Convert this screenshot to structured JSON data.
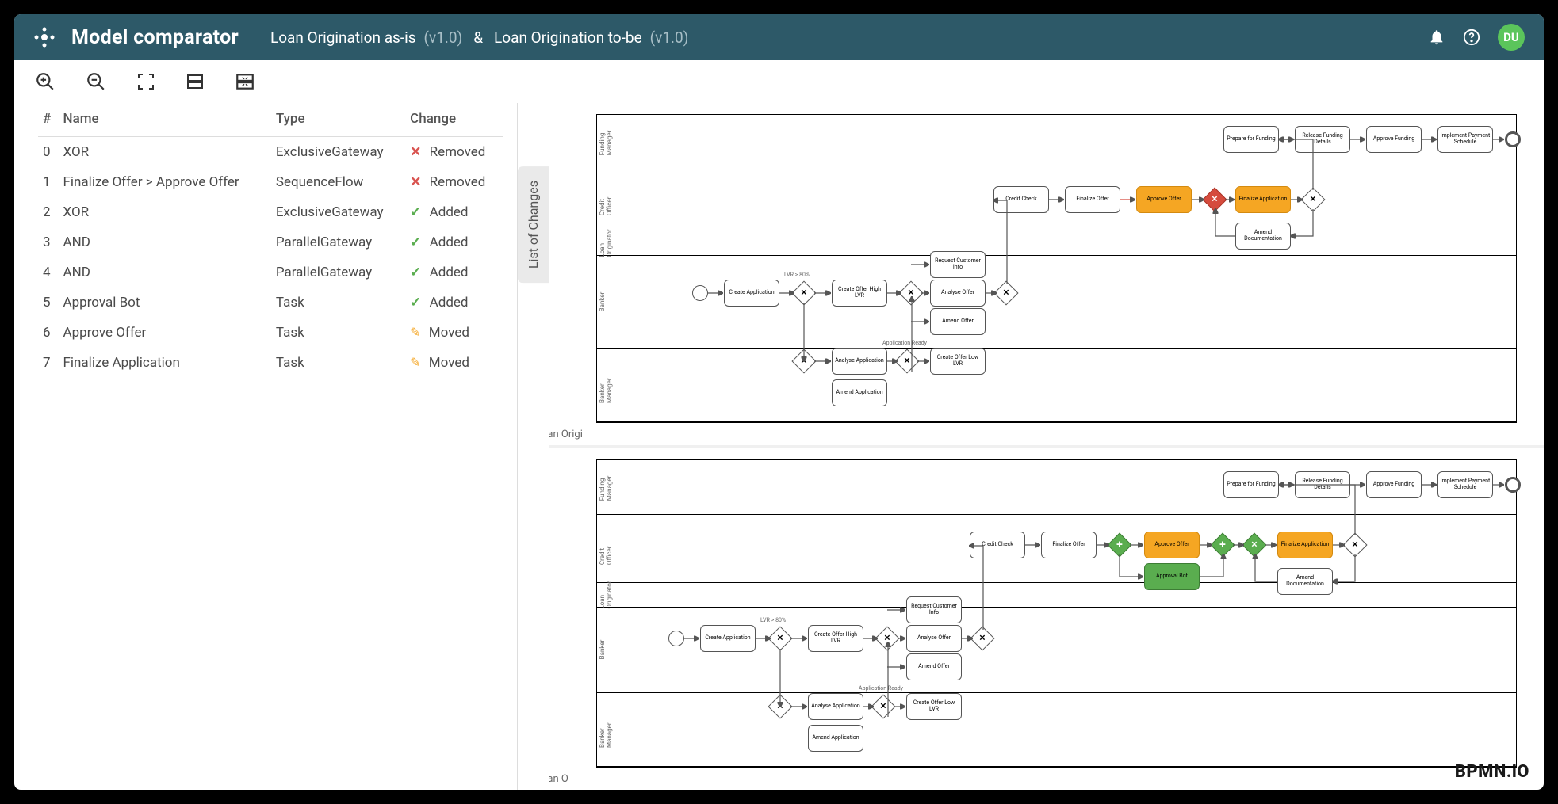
{
  "header": {
    "title": "Model comparator",
    "model_a": "Loan Origination as-is",
    "version_a": "(v1.0)",
    "sep": "&",
    "model_b": "Loan Origination to-be",
    "version_b": "(v1.0)",
    "avatar": "DU"
  },
  "table": {
    "headers": {
      "idx": "#",
      "name": "Name",
      "type": "Type",
      "change": "Change"
    },
    "rows": [
      {
        "idx": "0",
        "name": "XOR",
        "type": "ExclusiveGateway",
        "change": "Removed",
        "kind": "removed"
      },
      {
        "idx": "1",
        "name": "Finalize Offer > Approve Offer",
        "type": "SequenceFlow",
        "change": "Removed",
        "kind": "removed"
      },
      {
        "idx": "2",
        "name": "XOR",
        "type": "ExclusiveGateway",
        "change": "Added",
        "kind": "added"
      },
      {
        "idx": "3",
        "name": "AND",
        "type": "ParallelGateway",
        "change": "Added",
        "kind": "added"
      },
      {
        "idx": "4",
        "name": "AND",
        "type": "ParallelGateway",
        "change": "Added",
        "kind": "added"
      },
      {
        "idx": "5",
        "name": "Approval Bot",
        "type": "Task",
        "change": "Added",
        "kind": "added"
      },
      {
        "idx": "6",
        "name": "Approve Offer",
        "type": "Task",
        "change": "Moved",
        "kind": "moved"
      },
      {
        "idx": "7",
        "name": "Finalize Application",
        "type": "Task",
        "change": "Moved",
        "kind": "moved"
      }
    ]
  },
  "sidebar": {
    "list_tab": "List of Changes"
  },
  "diagram_top": {
    "pool_label": "Loan Origi",
    "lanes": [
      "Funding Manager",
      "Credit Officer",
      "Loan Originator",
      "Banker",
      "Banker Manager"
    ],
    "tasks": {
      "credit_check": "Credit Check",
      "finalize_offer": "Finalize Offer",
      "approve_offer": "Approve Offer",
      "finalize_app": "Finalize Application",
      "amend_doc": "Amend Documentation",
      "prepare_funding": "Prepare for Funding",
      "release_funding": "Release Funding Details",
      "approve_funding": "Approve Funding",
      "implement_payment": "Implement Payment Schedule",
      "create_app": "Create Application",
      "create_offer_high": "Create Offer High LVR",
      "request_info": "Request Customer Info",
      "analyze_offer": "Analyse Offer",
      "amend_offer": "Amend Offer",
      "analyze_app": "Analyse Application",
      "create_offer_low": "Create Offer Low LVR",
      "amend_app": "Amend Application"
    },
    "labels": {
      "lvr_80": "LVR > 80%",
      "app_ready": "Application Ready"
    }
  },
  "diagram_bottom": {
    "pool_label": "Loan O",
    "tasks": {
      "approval_bot": "Approval Bot"
    }
  },
  "footer": {
    "bpmn": "BPMN.iO"
  }
}
